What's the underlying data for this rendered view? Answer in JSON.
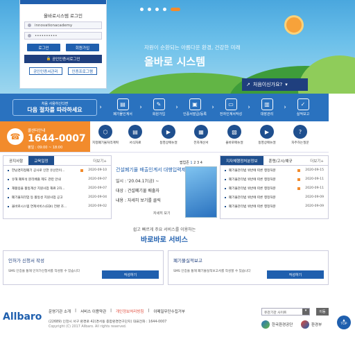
{
  "login": {
    "title": "올바로시스템 로그인",
    "id_value": "innovationacademy",
    "pw_mask": "••••••••••",
    "login_btn": "로그인",
    "join_btn": "회원가입",
    "cert_login": "공인인증서로그인",
    "cert_manage": "공인인증서관리",
    "cert_program": "인증프로그램"
  },
  "hero": {
    "slogan": "자원이 순환되는 아름다운 환경, 건강한 미래",
    "title": "올바로 시스템",
    "beginner_btn": "처음이신가요?"
  },
  "process": {
    "small": "처음 사용하신다면",
    "big": "다음 절차를 따라하세요",
    "steps": [
      "폐기물인계서",
      "회원가입",
      "인증서발급/등록",
      "전자인계서작성",
      "대장관리",
      "실적보고"
    ]
  },
  "call": {
    "label": "콜센터안내",
    "number": "1644-0007",
    "hours": "평일 : 09:00 ~ 18:00"
  },
  "services": [
    "지정폐기물처리계획",
    "서식자료",
    "동영상매뉴얼",
    "전자계산서",
    "올바로매뉴얼",
    "동영상매뉴얼",
    "자주하는질문"
  ],
  "left_panel": {
    "tabs": [
      "공지사항",
      "교육일정"
    ],
    "more": "더보기+",
    "rows": [
      {
        "text": "한남경지정폐기 공사로 인한 유산전이...",
        "date": "2020-09-10",
        "new": true
      },
      {
        "text": "유해 폐토석 분리배출 제도 관련 안내",
        "date": "2020-09-07",
        "new": false
      },
      {
        "text": "재활용을 활동계산 지원사업 재료 2차...",
        "date": "2020-09-07",
        "new": false
      },
      {
        "text": "폐기물처리업 등 활동성 지원사업 공고",
        "date": "2020-09-04",
        "new": false
      },
      {
        "text": "올바로시스템 연계서비스(EDI) 전환 조...",
        "date": "2020-09-02",
        "new": false
      }
    ]
  },
  "notice": {
    "pager_label": "팝업존",
    "pages": [
      "1",
      "2",
      "3",
      "4"
    ],
    "title": "건설폐기물 배출인계서 대행입력제도 시행안내",
    "line1": "일시 : '20.04.17(금) ~",
    "line2": "대상 : 건설폐기물 배출자",
    "line3": "내용 : 자세히 보기를 클릭",
    "link": "자세히 보기"
  },
  "right_panel": {
    "tabs": [
      "지자체행정처분정보",
      "훈령/고시/예규"
    ],
    "more": "더보기+",
    "rows": [
      {
        "text": "폐기물관리법 위반에 따른 행정처분",
        "date": "2020-09-15",
        "new": true
      },
      {
        "text": "폐기물관리법 위반에 따른 행정처분",
        "date": "2020-09-11",
        "new": true
      },
      {
        "text": "폐기물관리법 위반에 따른 행정처분",
        "date": "2020-09-11",
        "new": true
      },
      {
        "text": "폐기물관리법 위반에 따른 행정처분",
        "date": "2020-09-09",
        "new": false
      },
      {
        "text": "폐기물관리법 위반에 따른 행정처분",
        "date": "2020-09-09",
        "new": false
      }
    ]
  },
  "section": {
    "sub": "쉽고 빠르게 주요 서비스를 이용하는",
    "title": "바로바로 서비스"
  },
  "cards": [
    {
      "title": "인허가 신청서 작성",
      "desc": "SMS 인증을 통해 인허가신청서를 작성할 수 있습니다",
      "btn": "작성하기"
    },
    {
      "title": "폐기물실적보고",
      "desc": "SMS 인증을 통해 폐기물실적보고서를 작성할 수 있습니다",
      "btn": "작성하기"
    }
  ],
  "footer": {
    "logo_a": "All",
    "logo_b": "baro",
    "links": [
      "운영기관 소개",
      "서비스 이용약관",
      "개인정보처리방침",
      "이메일무단수집거부"
    ],
    "address": "(22689) 인천시 서구 환경로 42(경서동 종합환경연구단지)  대표전화 : 1644-0007",
    "copyright": "Copyright (C) 2017 Allbaro. All rights reserved.",
    "site_select": "유관기관 사이트",
    "go": "이동",
    "org1": "한국환경공단",
    "org2": "환경부",
    "top": "TOP"
  },
  "colors": {
    "primary": "#1f5fae",
    "accent": "#f28b2c",
    "dark": "#1f3f7e"
  }
}
